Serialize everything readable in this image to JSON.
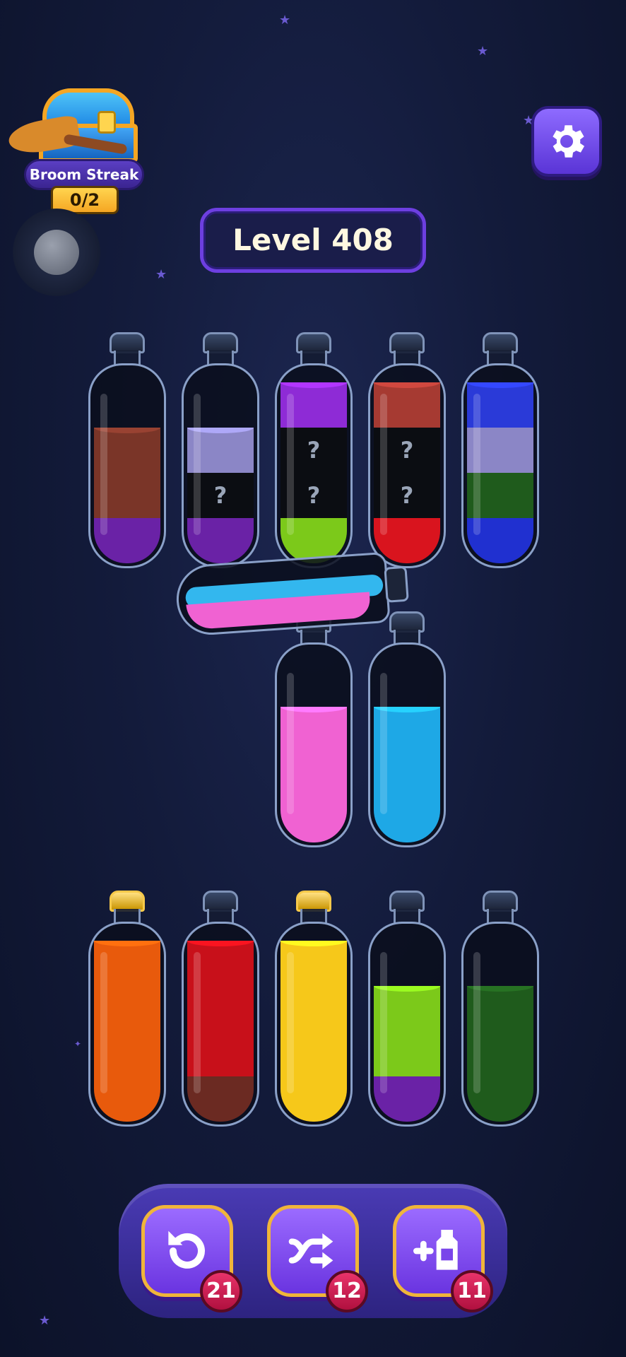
{
  "streak": {
    "label": "Broom Streak",
    "count": "0/2"
  },
  "level": {
    "label": "Level 408"
  },
  "tubes_top": [
    {
      "segments": [
        "#6a22a6",
        "#7a3528",
        "#7a3528"
      ]
    },
    {
      "segments": [
        "#6a22a6",
        "?",
        "#8b86c6"
      ]
    },
    {
      "segments": [
        "#7cc91a",
        "?",
        "?",
        "#8e2bd6"
      ]
    },
    {
      "segments": [
        "#d9141e",
        "?",
        "?",
        "#a63a32"
      ]
    },
    {
      "segments": [
        "#2030d0",
        "#1f5b1c",
        "#8b86c6",
        "#2a3ad8"
      ]
    }
  ],
  "tubes_middle": [
    {
      "segments": [
        "#f062d2",
        "#f062d2",
        "#f062d2"
      ]
    },
    {
      "segments": [
        "#1ea8e6",
        "#1ea8e6",
        "#1ea8e6"
      ]
    }
  ],
  "pouring_tube": {
    "segments": [
      "#f062d2",
      "#33b7ee"
    ]
  },
  "tubes_bottom": [
    {
      "capped": true,
      "segments": [
        "#e85a0c",
        "#e85a0c",
        "#e85a0c",
        "#e85a0c"
      ]
    },
    {
      "capped": false,
      "segments": [
        "#6b2a22",
        "#c8101a",
        "#c8101a",
        "#c8101a"
      ]
    },
    {
      "capped": true,
      "segments": [
        "#f6c81a",
        "#f6c81a",
        "#f6c81a",
        "#f6c81a"
      ]
    },
    {
      "capped": false,
      "segments": [
        "#6a22a6",
        "#7cc91a",
        "#7cc91a"
      ]
    },
    {
      "capped": false,
      "segments": [
        "#1f5b1c",
        "#1f5b1c",
        "#1f5b1c"
      ]
    }
  ],
  "powerups": {
    "undo": {
      "icon": "undo-icon",
      "count": "21"
    },
    "shuffle": {
      "icon": "shuffle-icon",
      "count": "12"
    },
    "add_tube": {
      "icon": "add-bottle-icon",
      "count": "11"
    }
  }
}
